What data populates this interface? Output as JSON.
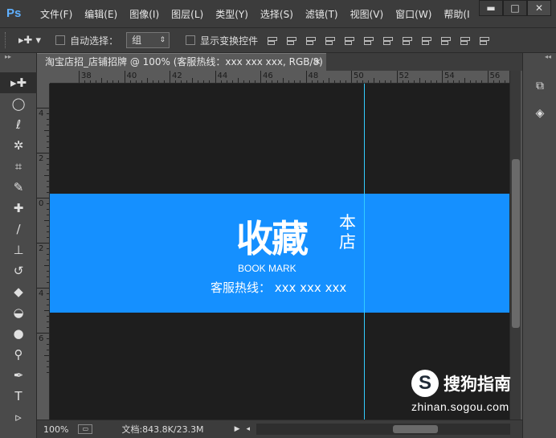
{
  "app": {
    "logo": "Ps"
  },
  "menu": {
    "items": [
      "文件(F)",
      "编辑(E)",
      "图像(I)",
      "图层(L)",
      "类型(Y)",
      "选择(S)",
      "滤镜(T)",
      "视图(V)",
      "窗口(W)",
      "帮助(I"
    ]
  },
  "window_controls": {
    "minimize": "▬",
    "maximize": "□",
    "close": "✕"
  },
  "options": {
    "tool_glyph": "▸✚ ▾",
    "auto_select_label": "自动选择：",
    "auto_select_value": "组",
    "show_transform_label": "显示变换控件"
  },
  "document": {
    "tab_title": "淘宝店招_店铺招牌 @ 100% (客服热线：xxx xxx xxx, RGB/8) *",
    "tab_close": "×"
  },
  "ruler": {
    "top_labels": [
      "38",
      "40",
      "42",
      "44",
      "46",
      "48",
      "50",
      "52",
      "54",
      "56"
    ],
    "left_labels": [
      "4",
      "2",
      "0",
      "2",
      "4",
      "6"
    ]
  },
  "banner": {
    "title_big": "收藏",
    "title_small": "本店",
    "subtitle": "BOOK MARK",
    "hotline": "客服热线：  xxx xxx xxx"
  },
  "status": {
    "zoom": "100%",
    "doc_info": "文档:843.8K/23.3M"
  },
  "watermark": {
    "brand": "搜狗指南",
    "url": "zhinan.sogou.com"
  },
  "icons": {
    "tools": [
      "move-icon",
      "elliptical-marquee-icon",
      "lasso-icon",
      "magic-wand-icon",
      "crop-icon",
      "eyedropper-icon",
      "healing-brush-icon",
      "brush-icon",
      "clone-stamp-icon",
      "history-brush-icon",
      "eraser-icon",
      "paint-bucket-icon",
      "blur-icon",
      "dodge-icon",
      "pen-icon",
      "type-icon",
      "path-selection-icon"
    ],
    "panels": [
      "history-panel-icon",
      "3d-panel-icon"
    ]
  }
}
